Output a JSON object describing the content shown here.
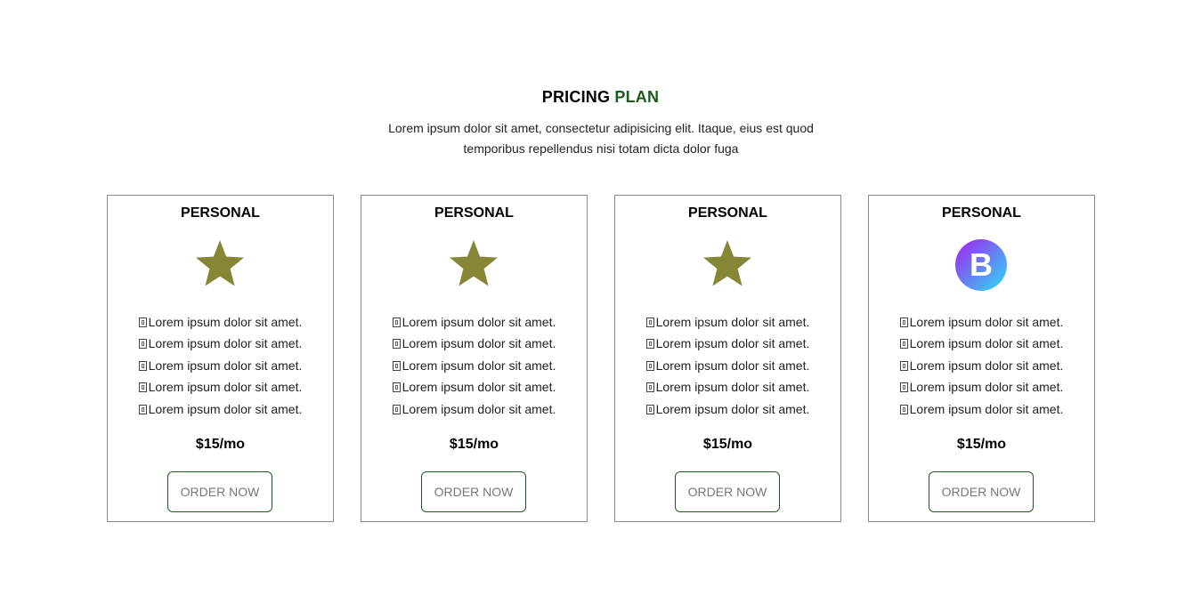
{
  "header": {
    "title_main": "PRICING",
    "title_accent": "PLAN",
    "subtitle_line1": "Lorem ipsum dolor sit amet, consectetur adipisicing elit. Itaque, eius est quod",
    "subtitle_line2": "temporibus repellendus nisi totam dicta dolor fuga"
  },
  "colors": {
    "accent": "#1d5b1d",
    "star": "#868637",
    "card_border": "#8a8a8a",
    "logo_gradient_start": "#a51df0",
    "logo_gradient_end": "#2be0f5"
  },
  "cards": [
    {
      "title": "PERSONAL",
      "icon": "star-icon",
      "features": [
        "Lorem ipsum dolor sit amet.",
        "Lorem ipsum dolor sit amet.",
        "Lorem ipsum dolor sit amet.",
        "Lorem ipsum dolor sit amet.",
        "Lorem ipsum dolor sit amet."
      ],
      "price": "$15/mo",
      "button_label": "ORDER NOW"
    },
    {
      "title": "PERSONAL",
      "icon": "star-icon",
      "features": [
        "Lorem ipsum dolor sit amet.",
        "Lorem ipsum dolor sit amet.",
        "Lorem ipsum dolor sit amet.",
        "Lorem ipsum dolor sit amet.",
        "Lorem ipsum dolor sit amet."
      ],
      "price": "$15/mo",
      "button_label": "ORDER NOW"
    },
    {
      "title": "PERSONAL",
      "icon": "star-icon",
      "features": [
        "Lorem ipsum dolor sit amet.",
        "Lorem ipsum dolor sit amet.",
        "Lorem ipsum dolor sit amet.",
        "Lorem ipsum dolor sit amet.",
        "Lorem ipsum dolor sit amet."
      ],
      "price": "$15/mo",
      "button_label": "ORDER NOW"
    },
    {
      "title": "PERSONAL",
      "icon": "bootstrap-logo-icon",
      "icon_letter": "B",
      "features": [
        "Lorem ipsum dolor sit amet.",
        "Lorem ipsum dolor sit amet.",
        "Lorem ipsum dolor sit amet.",
        "Lorem ipsum dolor sit amet.",
        "Lorem ipsum dolor sit amet."
      ],
      "price": "$15/mo",
      "button_label": "ORDER NOW"
    }
  ]
}
